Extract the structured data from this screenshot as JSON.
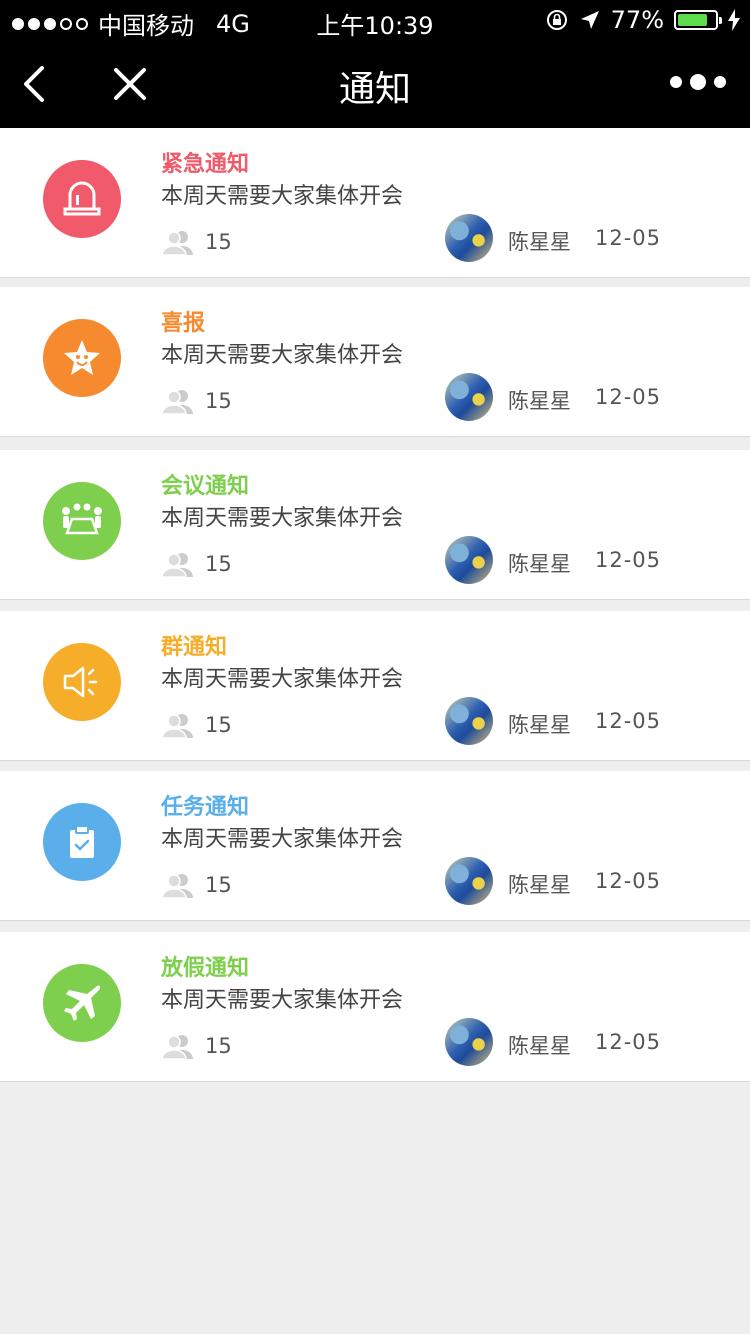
{
  "status": {
    "carrier": "中国移动",
    "network": "4G",
    "time": "上午10:39",
    "battery": "77%"
  },
  "nav": {
    "title": "通知"
  },
  "colors": {
    "urgent": "#f05a6a",
    "good_news": "#f68a2e",
    "meeting": "#7fcf4e",
    "group": "#f6ae2a",
    "task": "#5aaeea",
    "holiday": "#7fcf4e"
  },
  "notifications": [
    {
      "title": "紧急通知",
      "body": "本周天需要大家集体开会",
      "count": "15",
      "sender": "陈星星",
      "date": "12-05",
      "icon": "alarm-light-icon"
    },
    {
      "title": "喜报",
      "body": "本周天需要大家集体开会",
      "count": "15",
      "sender": "陈星星",
      "date": "12-05",
      "icon": "star-face-icon"
    },
    {
      "title": "会议通知",
      "body": "本周天需要大家集体开会",
      "count": "15",
      "sender": "陈星星",
      "date": "12-05",
      "icon": "meeting-table-icon"
    },
    {
      "title": "群通知",
      "body": "本周天需要大家集体开会",
      "count": "15",
      "sender": "陈星星",
      "date": "12-05",
      "icon": "speaker-icon"
    },
    {
      "title": "任务通知",
      "body": "本周天需要大家集体开会",
      "count": "15",
      "sender": "陈星星",
      "date": "12-05",
      "icon": "clipboard-check-icon"
    },
    {
      "title": "放假通知",
      "body": "本周天需要大家集体开会",
      "count": "15",
      "sender": "陈星星",
      "date": "12-05",
      "icon": "airplane-icon"
    }
  ]
}
